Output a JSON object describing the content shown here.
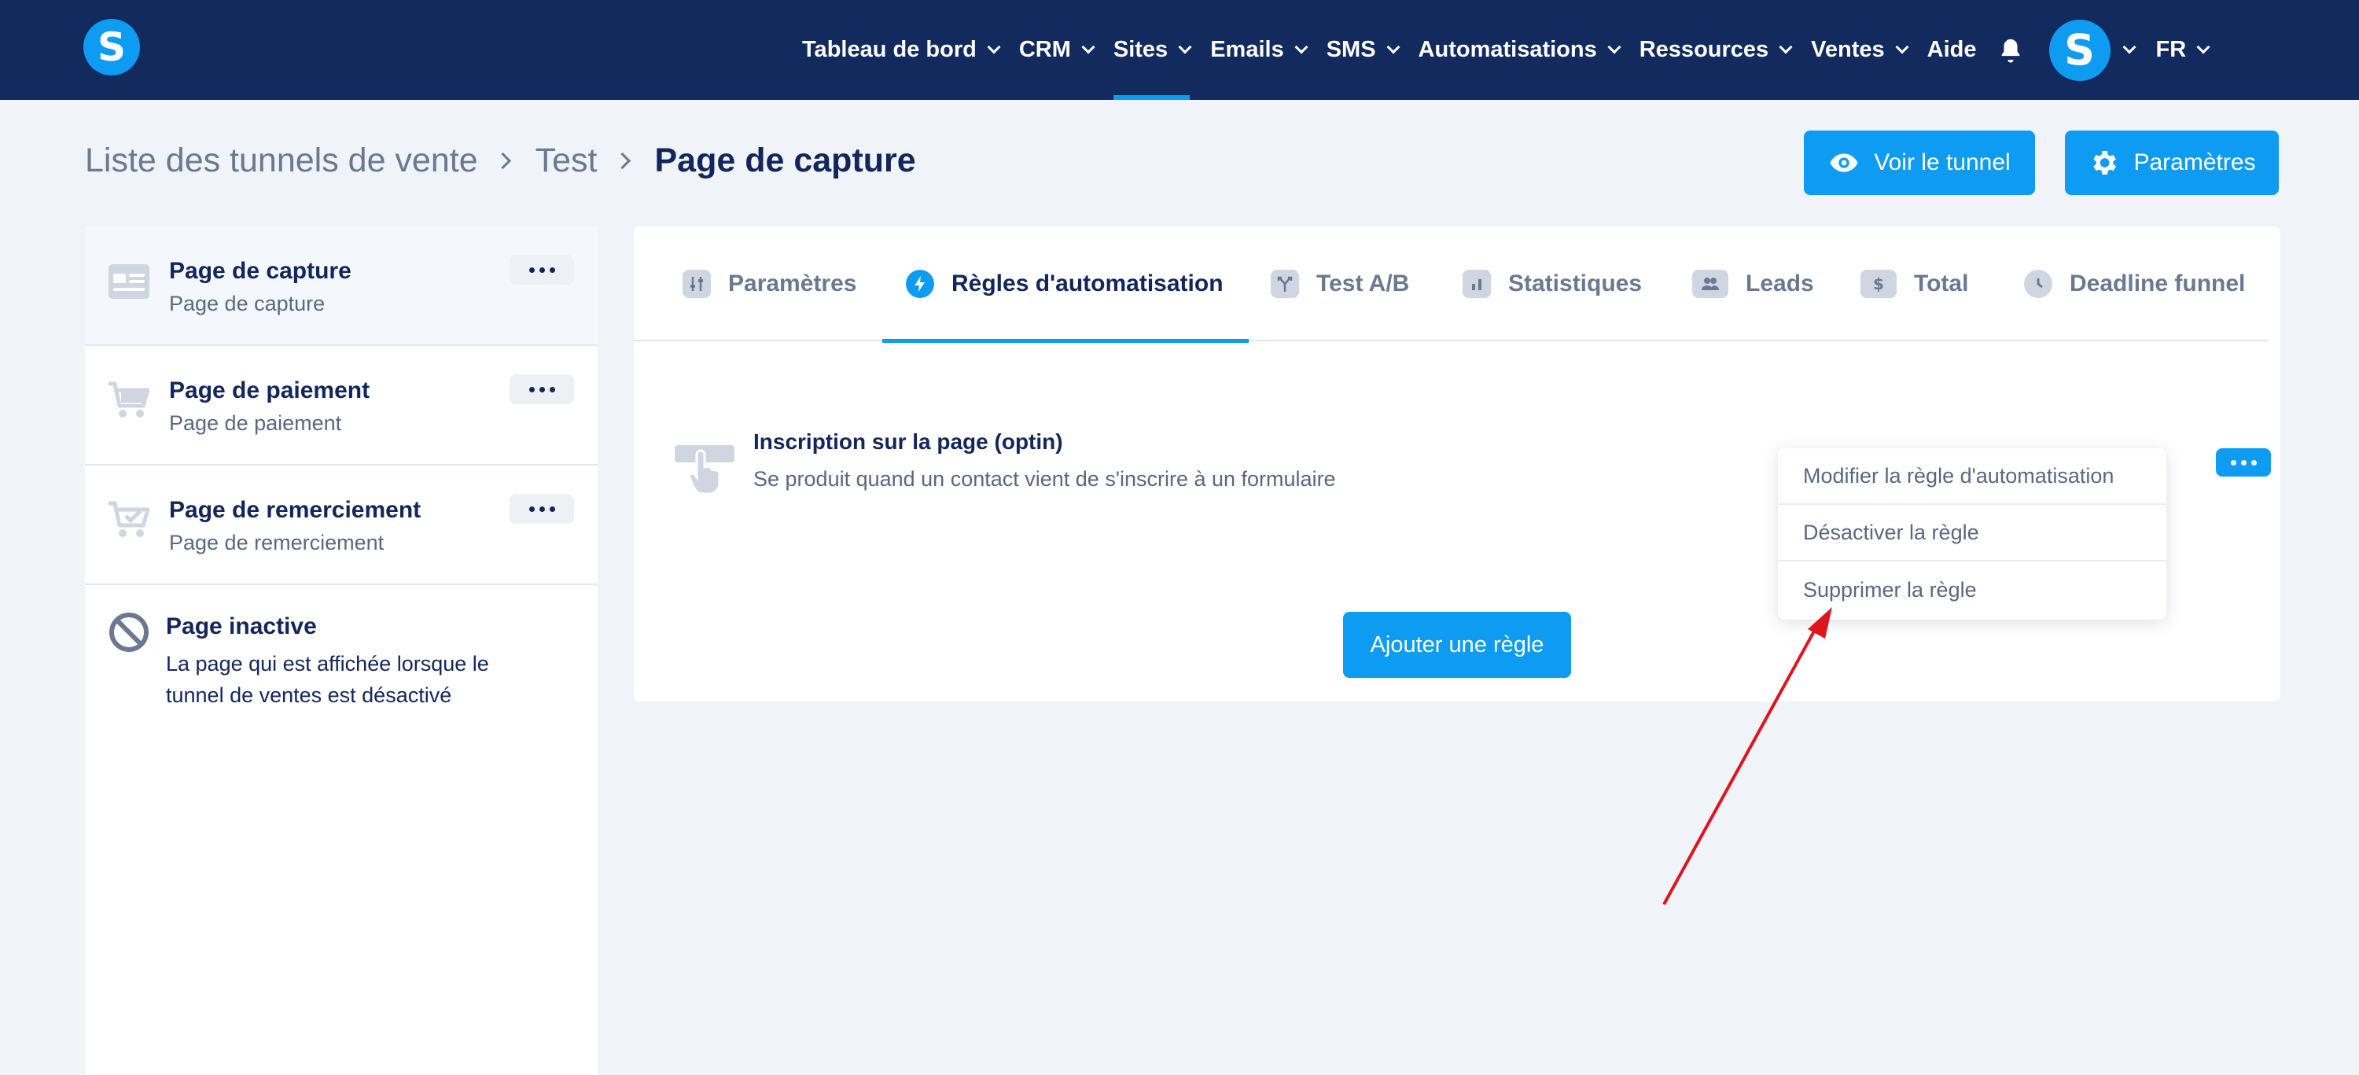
{
  "brand": {
    "logo_letter": "S"
  },
  "nav": {
    "items": [
      {
        "label": "Tableau de bord",
        "has_dropdown": true
      },
      {
        "label": "CRM",
        "has_dropdown": true
      },
      {
        "label": "Sites",
        "has_dropdown": true,
        "active": true
      },
      {
        "label": "Emails",
        "has_dropdown": true
      },
      {
        "label": "SMS",
        "has_dropdown": true
      },
      {
        "label": "Automatisations",
        "has_dropdown": true
      },
      {
        "label": "Ressources",
        "has_dropdown": true
      },
      {
        "label": "Ventes",
        "has_dropdown": true
      },
      {
        "label": "Aide",
        "has_dropdown": false
      }
    ],
    "avatar_letter": "S",
    "language": "FR"
  },
  "breadcrumb": {
    "items": [
      "Liste des tunnels de vente",
      "Test",
      "Page de capture"
    ]
  },
  "header_buttons": {
    "view_funnel": "Voir le tunnel",
    "settings": "Paramètres"
  },
  "sidebar": {
    "pages": [
      {
        "title": "Page de capture",
        "subtitle": "Page de capture",
        "icon": "form-page-icon",
        "active": true
      },
      {
        "title": "Page de paiement",
        "subtitle": "Page de paiement",
        "icon": "cart-icon"
      },
      {
        "title": "Page de remerciement",
        "subtitle": "Page de remerciement",
        "icon": "cart-check-icon"
      }
    ],
    "inactive": {
      "title": "Page inactive",
      "description": "La page qui est affichée lorsque le tunnel de ventes est désactivé"
    }
  },
  "tabs": [
    {
      "label": "Paramètres",
      "icon": "sliders-icon"
    },
    {
      "label": "Règles d'automatisation",
      "icon": "bolt-icon",
      "active": true
    },
    {
      "label": "Test A/B",
      "icon": "split-icon"
    },
    {
      "label": "Statistiques",
      "icon": "bar-chart-icon"
    },
    {
      "label": "Leads",
      "icon": "users-icon"
    },
    {
      "label": "Total",
      "icon": "dollar-icon"
    },
    {
      "label": "Deadline funnel",
      "icon": "clock-icon"
    }
  ],
  "rule": {
    "title": "Inscription sur la page (optin)",
    "description": "Se produit quand un contact vient de s'inscrire à un formulaire"
  },
  "rule_menu": {
    "items": [
      "Modifier la règle d'automatisation",
      "Désactiver la règle",
      "Supprimer la règle"
    ]
  },
  "add_rule_button": "Ajouter une règle",
  "colors": {
    "navbar": "#132a5e",
    "accent": "#0d9cf2",
    "background": "#f0f3f8",
    "annotation_arrow": "#e0141e"
  }
}
